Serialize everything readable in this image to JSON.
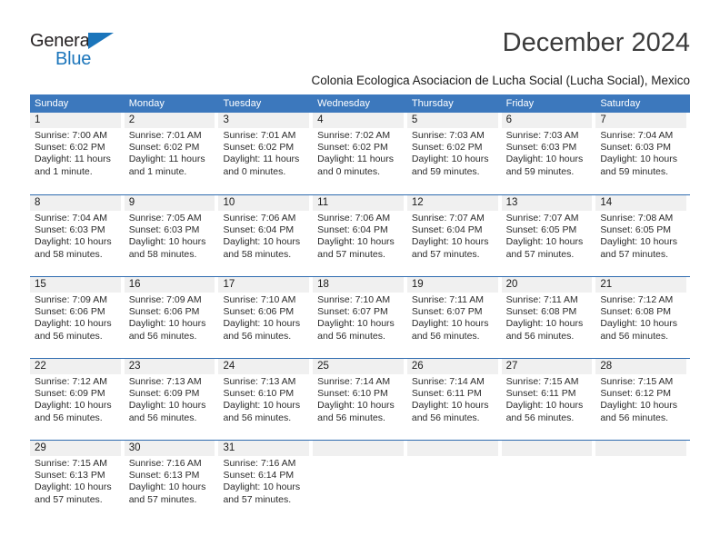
{
  "brand": {
    "name_part1": "General",
    "name_part2": "Blue",
    "triangle_icon": "blue-triangle-icon",
    "accent_color": "#1b75bb"
  },
  "header": {
    "month_title": "December 2024",
    "location": "Colonia Ecologica Asociacion de Lucha Social (Lucha Social), Mexico"
  },
  "colors": {
    "weekday_header_bg": "#3c78bd",
    "weekday_header_text": "#ffffff",
    "day_band_bg": "#f0f0f0",
    "row_divider": "#2f6cb0"
  },
  "weekdays": [
    {
      "label": "Sunday"
    },
    {
      "label": "Monday"
    },
    {
      "label": "Tuesday"
    },
    {
      "label": "Wednesday"
    },
    {
      "label": "Thursday"
    },
    {
      "label": "Friday"
    },
    {
      "label": "Saturday"
    }
  ],
  "weeks": [
    {
      "days": [
        {
          "number": "1",
          "sunrise": "Sunrise: 7:00 AM",
          "sunset": "Sunset: 6:02 PM",
          "daylight_line1": "Daylight: 11 hours",
          "daylight_line2": "and 1 minute."
        },
        {
          "number": "2",
          "sunrise": "Sunrise: 7:01 AM",
          "sunset": "Sunset: 6:02 PM",
          "daylight_line1": "Daylight: 11 hours",
          "daylight_line2": "and 1 minute."
        },
        {
          "number": "3",
          "sunrise": "Sunrise: 7:01 AM",
          "sunset": "Sunset: 6:02 PM",
          "daylight_line1": "Daylight: 11 hours",
          "daylight_line2": "and 0 minutes."
        },
        {
          "number": "4",
          "sunrise": "Sunrise: 7:02 AM",
          "sunset": "Sunset: 6:02 PM",
          "daylight_line1": "Daylight: 11 hours",
          "daylight_line2": "and 0 minutes."
        },
        {
          "number": "5",
          "sunrise": "Sunrise: 7:03 AM",
          "sunset": "Sunset: 6:02 PM",
          "daylight_line1": "Daylight: 10 hours",
          "daylight_line2": "and 59 minutes."
        },
        {
          "number": "6",
          "sunrise": "Sunrise: 7:03 AM",
          "sunset": "Sunset: 6:03 PM",
          "daylight_line1": "Daylight: 10 hours",
          "daylight_line2": "and 59 minutes."
        },
        {
          "number": "7",
          "sunrise": "Sunrise: 7:04 AM",
          "sunset": "Sunset: 6:03 PM",
          "daylight_line1": "Daylight: 10 hours",
          "daylight_line2": "and 59 minutes."
        }
      ]
    },
    {
      "days": [
        {
          "number": "8",
          "sunrise": "Sunrise: 7:04 AM",
          "sunset": "Sunset: 6:03 PM",
          "daylight_line1": "Daylight: 10 hours",
          "daylight_line2": "and 58 minutes."
        },
        {
          "number": "9",
          "sunrise": "Sunrise: 7:05 AM",
          "sunset": "Sunset: 6:03 PM",
          "daylight_line1": "Daylight: 10 hours",
          "daylight_line2": "and 58 minutes."
        },
        {
          "number": "10",
          "sunrise": "Sunrise: 7:06 AM",
          "sunset": "Sunset: 6:04 PM",
          "daylight_line1": "Daylight: 10 hours",
          "daylight_line2": "and 58 minutes."
        },
        {
          "number": "11",
          "sunrise": "Sunrise: 7:06 AM",
          "sunset": "Sunset: 6:04 PM",
          "daylight_line1": "Daylight: 10 hours",
          "daylight_line2": "and 57 minutes."
        },
        {
          "number": "12",
          "sunrise": "Sunrise: 7:07 AM",
          "sunset": "Sunset: 6:04 PM",
          "daylight_line1": "Daylight: 10 hours",
          "daylight_line2": "and 57 minutes."
        },
        {
          "number": "13",
          "sunrise": "Sunrise: 7:07 AM",
          "sunset": "Sunset: 6:05 PM",
          "daylight_line1": "Daylight: 10 hours",
          "daylight_line2": "and 57 minutes."
        },
        {
          "number": "14",
          "sunrise": "Sunrise: 7:08 AM",
          "sunset": "Sunset: 6:05 PM",
          "daylight_line1": "Daylight: 10 hours",
          "daylight_line2": "and 57 minutes."
        }
      ]
    },
    {
      "days": [
        {
          "number": "15",
          "sunrise": "Sunrise: 7:09 AM",
          "sunset": "Sunset: 6:06 PM",
          "daylight_line1": "Daylight: 10 hours",
          "daylight_line2": "and 56 minutes."
        },
        {
          "number": "16",
          "sunrise": "Sunrise: 7:09 AM",
          "sunset": "Sunset: 6:06 PM",
          "daylight_line1": "Daylight: 10 hours",
          "daylight_line2": "and 56 minutes."
        },
        {
          "number": "17",
          "sunrise": "Sunrise: 7:10 AM",
          "sunset": "Sunset: 6:06 PM",
          "daylight_line1": "Daylight: 10 hours",
          "daylight_line2": "and 56 minutes."
        },
        {
          "number": "18",
          "sunrise": "Sunrise: 7:10 AM",
          "sunset": "Sunset: 6:07 PM",
          "daylight_line1": "Daylight: 10 hours",
          "daylight_line2": "and 56 minutes."
        },
        {
          "number": "19",
          "sunrise": "Sunrise: 7:11 AM",
          "sunset": "Sunset: 6:07 PM",
          "daylight_line1": "Daylight: 10 hours",
          "daylight_line2": "and 56 minutes."
        },
        {
          "number": "20",
          "sunrise": "Sunrise: 7:11 AM",
          "sunset": "Sunset: 6:08 PM",
          "daylight_line1": "Daylight: 10 hours",
          "daylight_line2": "and 56 minutes."
        },
        {
          "number": "21",
          "sunrise": "Sunrise: 7:12 AM",
          "sunset": "Sunset: 6:08 PM",
          "daylight_line1": "Daylight: 10 hours",
          "daylight_line2": "and 56 minutes."
        }
      ]
    },
    {
      "days": [
        {
          "number": "22",
          "sunrise": "Sunrise: 7:12 AM",
          "sunset": "Sunset: 6:09 PM",
          "daylight_line1": "Daylight: 10 hours",
          "daylight_line2": "and 56 minutes."
        },
        {
          "number": "23",
          "sunrise": "Sunrise: 7:13 AM",
          "sunset": "Sunset: 6:09 PM",
          "daylight_line1": "Daylight: 10 hours",
          "daylight_line2": "and 56 minutes."
        },
        {
          "number": "24",
          "sunrise": "Sunrise: 7:13 AM",
          "sunset": "Sunset: 6:10 PM",
          "daylight_line1": "Daylight: 10 hours",
          "daylight_line2": "and 56 minutes."
        },
        {
          "number": "25",
          "sunrise": "Sunrise: 7:14 AM",
          "sunset": "Sunset: 6:10 PM",
          "daylight_line1": "Daylight: 10 hours",
          "daylight_line2": "and 56 minutes."
        },
        {
          "number": "26",
          "sunrise": "Sunrise: 7:14 AM",
          "sunset": "Sunset: 6:11 PM",
          "daylight_line1": "Daylight: 10 hours",
          "daylight_line2": "and 56 minutes."
        },
        {
          "number": "27",
          "sunrise": "Sunrise: 7:15 AM",
          "sunset": "Sunset: 6:11 PM",
          "daylight_line1": "Daylight: 10 hours",
          "daylight_line2": "and 56 minutes."
        },
        {
          "number": "28",
          "sunrise": "Sunrise: 7:15 AM",
          "sunset": "Sunset: 6:12 PM",
          "daylight_line1": "Daylight: 10 hours",
          "daylight_line2": "and 56 minutes."
        }
      ]
    },
    {
      "days": [
        {
          "number": "29",
          "sunrise": "Sunrise: 7:15 AM",
          "sunset": "Sunset: 6:13 PM",
          "daylight_line1": "Daylight: 10 hours",
          "daylight_line2": "and 57 minutes."
        },
        {
          "number": "30",
          "sunrise": "Sunrise: 7:16 AM",
          "sunset": "Sunset: 6:13 PM",
          "daylight_line1": "Daylight: 10 hours",
          "daylight_line2": "and 57 minutes."
        },
        {
          "number": "31",
          "sunrise": "Sunrise: 7:16 AM",
          "sunset": "Sunset: 6:14 PM",
          "daylight_line1": "Daylight: 10 hours",
          "daylight_line2": "and 57 minutes."
        },
        {
          "number": "",
          "sunrise": "",
          "sunset": "",
          "daylight_line1": "",
          "daylight_line2": ""
        },
        {
          "number": "",
          "sunrise": "",
          "sunset": "",
          "daylight_line1": "",
          "daylight_line2": ""
        },
        {
          "number": "",
          "sunrise": "",
          "sunset": "",
          "daylight_line1": "",
          "daylight_line2": ""
        },
        {
          "number": "",
          "sunrise": "",
          "sunset": "",
          "daylight_line1": "",
          "daylight_line2": ""
        }
      ]
    }
  ]
}
